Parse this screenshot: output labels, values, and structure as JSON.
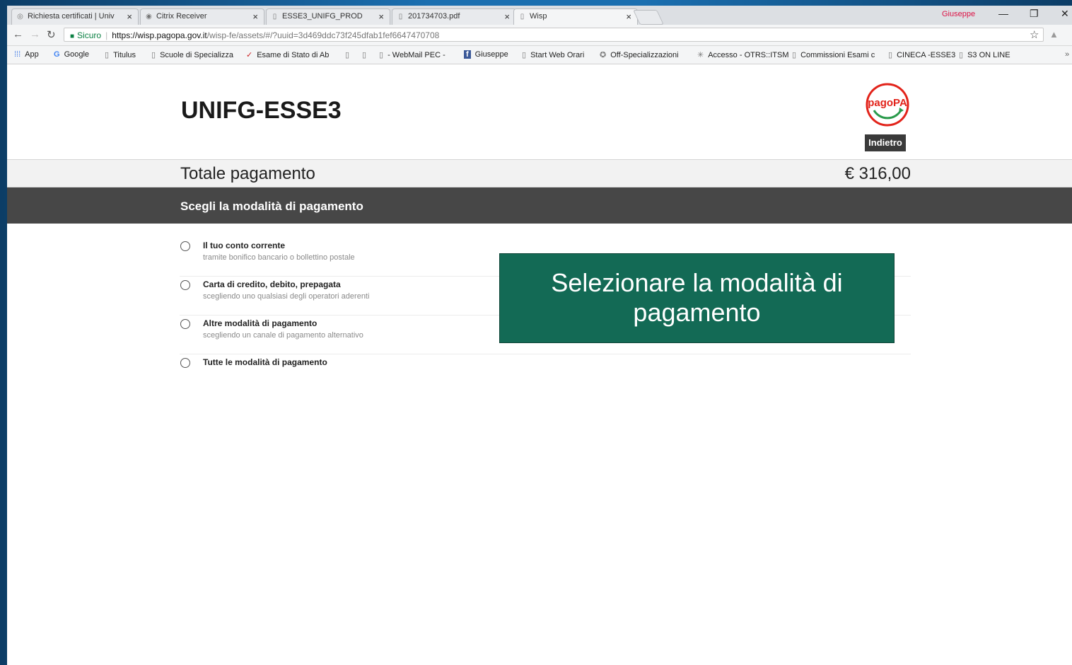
{
  "browser": {
    "tabs": [
      {
        "label": "Richiesta certificati | Univ",
        "icon": "globe-icon"
      },
      {
        "label": "Citrix Receiver",
        "icon": "citrix-icon"
      },
      {
        "label": "ESSE3_UNIFG_PROD",
        "icon": "page-icon"
      },
      {
        "label": "201734703.pdf",
        "icon": "page-icon"
      },
      {
        "label": "Wisp",
        "icon": "page-icon"
      }
    ],
    "user": "Giuseppe",
    "secure_label": "Sicuro",
    "url_host": "https://wisp.pagopa.gov.it",
    "url_rest": "/wisp-fe/assets/#/?uuid=3d469ddc73f245dfab1fef6647470708",
    "bookmarks": [
      "App",
      "Google",
      "Titulus",
      "Scuole di Specializza",
      "Esame di Stato di Ab",
      "",
      "",
      "- WebMail PEC -",
      "Giuseppe",
      "Start Web Orari",
      "Off-Specializzazioni",
      "Accesso - OTRS::ITSM",
      "Commissioni Esami c",
      "CINECA -ESSE3",
      "S3 ON LINE"
    ]
  },
  "page": {
    "title": "UNIFG-ESSE3",
    "logo_text": "pagoPA",
    "back_label": "Indietro",
    "total_label": "Totale pagamento",
    "total_value": "€ 316,00",
    "section_title": "Scegli la modalità di pagamento",
    "options": [
      {
        "title": "Il tuo conto corrente",
        "subtitle": "tramite bonifico bancario o bollettino postale"
      },
      {
        "title": "Carta di credito, debito, prepagata",
        "subtitle": "scegliendo uno qualsiasi degli operatori aderenti"
      },
      {
        "title": "Altre modalità di pagamento",
        "subtitle": "scegliendo un canale di pagamento alternativo"
      },
      {
        "title": "Tutte le modalità di pagamento",
        "subtitle": ""
      }
    ],
    "callout_line1": "Selezionare la modalità di",
    "callout_line2": "pagamento"
  },
  "colors": {
    "section_bg": "#474747",
    "callout_bg": "#136a55",
    "logo_red": "#e2231a",
    "logo_green": "#2a9a4b"
  }
}
